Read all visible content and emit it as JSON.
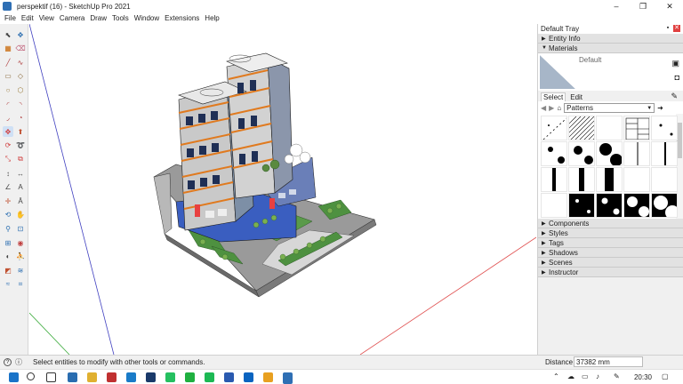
{
  "window": {
    "title": "perspektif (16) - SketchUp Pro 2021",
    "controls": [
      "–",
      "❐",
      "✕"
    ]
  },
  "menu": [
    "File",
    "Edit",
    "View",
    "Camera",
    "Draw",
    "Tools",
    "Window",
    "Extensions",
    "Help"
  ],
  "toolbar": {
    "icons": [
      "select-icon",
      "paint-bucket-icon",
      "make-component-icon",
      "eraser-icon",
      "line-icon",
      "freehand-icon",
      "rectangle-icon",
      "rotated-rectangle-icon",
      "circle-icon",
      "polygon-icon",
      "arc-icon",
      "two-point-arc-icon",
      "three-point-arc-icon",
      "pie-icon",
      "move-icon",
      "push-pull-icon",
      "rotate-icon",
      "follow-me-icon",
      "scale-icon",
      "offset-icon",
      "tape-measure-icon",
      "dimension-icon",
      "protractor-icon",
      "text-icon",
      "axes-icon",
      "3d-text-icon",
      "orbit-icon",
      "pan-icon",
      "zoom-icon",
      "zoom-window-icon",
      "zoom-extents-icon",
      "position-camera-icon",
      "look-around-icon",
      "walk-icon",
      "section-plane-icon",
      "sandbox-from-contours-icon",
      "sandbox-smoove-icon",
      "sandbox-stamp-icon"
    ]
  },
  "tray": {
    "title": "Default Tray",
    "panels_top": [
      "Entity Info"
    ],
    "materials": {
      "label": "Materials",
      "current": "Default",
      "tabs": [
        "Select",
        "Edit"
      ],
      "library": "Patterns"
    },
    "panels_bottom": [
      "Components",
      "Styles",
      "Tags",
      "Shadows",
      "Scenes",
      "Instructor"
    ]
  },
  "status": {
    "hint": "Select entities to modify with other tools or commands.",
    "distance_label": "Distance",
    "distance_value": "37382 mm"
  },
  "taskbar": {
    "time": "20:30",
    "apps": [
      "start-icon",
      "search-icon",
      "task-view-icon",
      "store-icon",
      "file-explorer-icon",
      "acrobat-icon",
      "edge-icon",
      "terminal-icon",
      "whatsapp-icon",
      "line-icon",
      "spotify-icon",
      "word-icon",
      "outlook-icon",
      "chrome-icon",
      "sketchup-icon"
    ]
  },
  "colors": {
    "accent": "#2f6fb4",
    "axis_red": "#e05050",
    "axis_green": "#3aaa3a",
    "axis_blue": "#4040c0"
  }
}
